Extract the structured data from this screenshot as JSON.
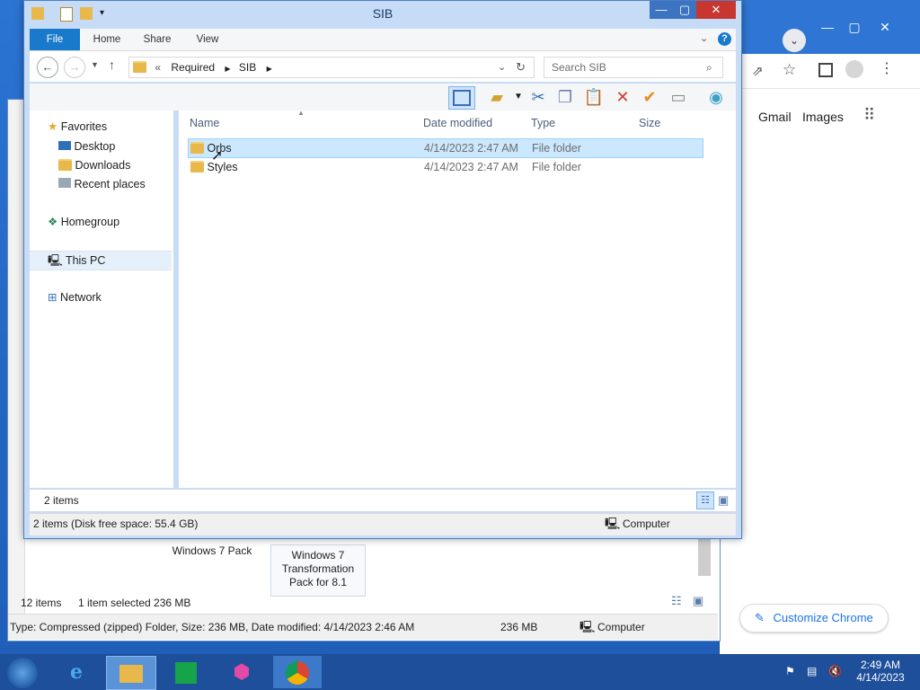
{
  "main_window": {
    "title": "SIB",
    "ribbon_tabs": [
      "File",
      "Home",
      "Share",
      "View"
    ],
    "breadcrumb": [
      "«",
      "Required",
      "SIB"
    ],
    "search_placeholder": "Search SIB",
    "nav_pane": {
      "favorites": "Favorites",
      "favorite_items": [
        "Desktop",
        "Downloads",
        "Recent places"
      ],
      "homegroup": "Homegroup",
      "this_pc": "This PC",
      "network": "Network"
    },
    "columns": {
      "name": "Name",
      "date": "Date modified",
      "type": "Type",
      "size": "Size"
    },
    "files": [
      {
        "name": "Orbs",
        "date": "4/14/2023 2:47 AM",
        "type": "File folder",
        "selected": true
      },
      {
        "name": "Styles",
        "date": "4/14/2023 2:47 AM",
        "type": "File folder",
        "selected": false
      }
    ],
    "item_count": "2 items",
    "status_free": "2 items (Disk free space: 55.4 GB)",
    "status_location": "Computer"
  },
  "background_window": {
    "tiles": [
      "Windows 7 Pack",
      "Windows 7 Transformation Pack for 8.1"
    ],
    "item_count": "12 items",
    "selected_info": "1 item selected  236 MB",
    "status_details": "Type: Compressed (zipped) Folder, Size: 236 MB, Date modified: 4/14/2023 2:46 AM",
    "status_size": "236 MB",
    "status_location": "Computer"
  },
  "chrome": {
    "links": [
      "Gmail",
      "Images"
    ],
    "customize_label": "Customize Chrome"
  },
  "taskbar": {
    "time": "2:49 AM",
    "date": "4/14/2023"
  }
}
